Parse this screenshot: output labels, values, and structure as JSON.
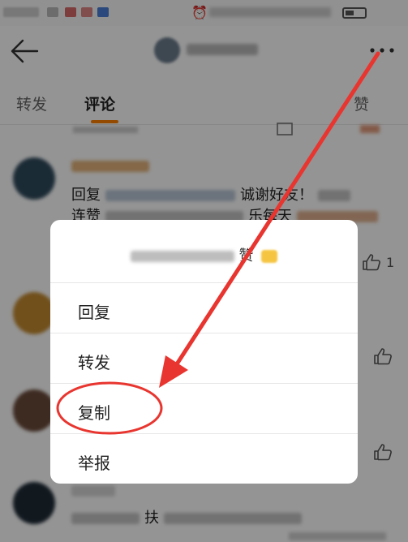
{
  "header": {
    "back_icon": "back-arrow-icon",
    "more_icon": "more-dots-icon"
  },
  "tabs": [
    {
      "label": "转发"
    },
    {
      "label": "评论"
    },
    {
      "label": "赞"
    }
  ],
  "comments": [
    {
      "line1_prefix": "回复",
      "line1_suffix": "诚谢好友！",
      "line2_prefix": "连赞",
      "line2_mid": "乐每天",
      "like_count": "1"
    },
    {
      "line1_prefix": "",
      "like_count": ""
    },
    {
      "line1_prefix": "",
      "like_count": ""
    },
    {
      "line1_mid": "扶",
      "like_count": ""
    }
  ],
  "dialog": {
    "title_visible": "赞",
    "items": [
      {
        "label": "回复"
      },
      {
        "label": "转发"
      },
      {
        "label": "复制"
      },
      {
        "label": "举报"
      }
    ]
  },
  "colors": {
    "accent": "#ff8200",
    "annotation": "#e8352f"
  }
}
